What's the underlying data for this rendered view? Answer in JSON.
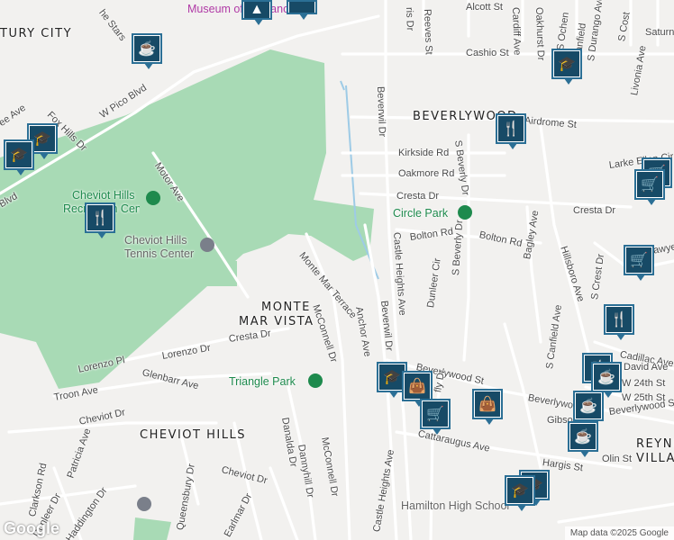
{
  "map": {
    "areas": {
      "century_city": "TURY CITY",
      "monte_mar_vista_1": "MONTE",
      "monte_mar_vista_2": "MAR VISTA",
      "beverlywood": "BEVERLYWOOD",
      "cheviot_hills": "CHEVIOT HILLS",
      "reynier_1": "REYNI",
      "reynier_2": "VILLA"
    },
    "parks": {
      "cheviot_rec_1": "Cheviot Hills",
      "cheviot_rec_2": "Recreation Center",
      "circle_park": "Circle Park",
      "triangle_park": "Triangle Park"
    },
    "pois": {
      "tennis_1": "Cheviot Hills",
      "tennis_2": "Tennis Center",
      "hamilton": "Hamilton High School",
      "museum": "Museum of Tolerance"
    },
    "streets": {
      "w_pico": "W Pico Blvd",
      "motor": "Motor Ave",
      "monte_mar_terrace": "Monte Mar Terrace",
      "mcconnell_1": "McConnell Dr",
      "mcconnell_2": "McConnell Dr",
      "anchor": "Anchor Ave",
      "beverwil_1": "Beverwil Dr",
      "beverwil_2": "Beverwil Dr",
      "castle_heights_1": "Castle Heights Ave",
      "castle_heights_2": "Castle Heights Ave",
      "cresta_1": "Cresta Dr",
      "cresta_2": "Cresta Dr",
      "cresta_3": "Cresta Dr",
      "lorenzo_dr": "Lorenzo Dr",
      "lorenzo_pl": "Lorenzo Pl",
      "glenbarr": "Glenbarr Ave",
      "troon": "Troon Ave",
      "cheviot_dr_1": "Cheviot Dr",
      "cheviot_dr_2": "Cheviot Dr",
      "patricia": "Patricia Ave",
      "clarkson": "Clarkson Rd",
      "dunleer": "Dunleer Dr",
      "haddington": "Haddington Dr",
      "queensbury": "Queensbury Dr",
      "earlmar": "Earlmar Dr",
      "danalda": "Danalda Dr",
      "dannyhill": "Dannyhill Dr",
      "mcconnell_3": "McConnell Dr",
      "kirkside": "Kirkside Rd",
      "oakmore": "Oakmore Rd",
      "bolton_1": "Bolton Rd",
      "bolton_2": "Bolton Rd",
      "s_beverly_1": "S Beverly Dr",
      "s_beverly_2": "S Beverly Dr",
      "dunleer_cir": "Dunleer Cir",
      "bagley": "Bagley Ave",
      "hillsboro": "Hillsboro Ave",
      "s_crest": "S Crest Dr",
      "s_canfield": "S Canfield Ave",
      "airdrome": "Airdrome St",
      "larke_ellen": "Larke Ellen Cir",
      "alcott": "Alcott St",
      "cashio": "Cashio St",
      "reeves": "Reeves St",
      "cardiff": "Cardiff Ave",
      "oakhurst": "Oakhurst Dr",
      "s_durango": "S Durango Ave",
      "livonia": "Livonia Ave",
      "s_cost": "S Cost",
      "saturn": "Saturn",
      "beverlywood_st_1": "Beverlywood St",
      "beverlywood_st_2": "Beverlywood St",
      "beverlywood_st_3": "Beverlywood St",
      "cattaraugus": "Cattaraugus Ave",
      "hargis": "Hargis St",
      "olin": "Olin St",
      "gibson": "Gibson",
      "cadillac": "Cadillac Ave",
      "david": "David Ave",
      "w_24th": "W 24th St",
      "w_25th": "W 25th St",
      "fox_hills": "Fox Hills Dr",
      "monte_stars": "he Stars",
      "s_oakhurst_partial": "ris Dr",
      "s_canfield_partial": "S Canfield",
      "s_schumacher_partial": "S Ochen",
      "lawyer_partial": "Sawye",
      "ee_ave": "ee Ave",
      "blvd_left": "Blvd",
      "fly_dr": "fly Dr"
    },
    "attribution": "Map data ©2025 Google",
    "google_logo": "Google",
    "markers": [
      {
        "type": "cafe-icon"
      },
      {
        "type": "school-icon"
      },
      {
        "type": "restaurant-icon"
      },
      {
        "type": "grocery-icon"
      },
      {
        "type": "shopping-bag-icon"
      }
    ]
  }
}
